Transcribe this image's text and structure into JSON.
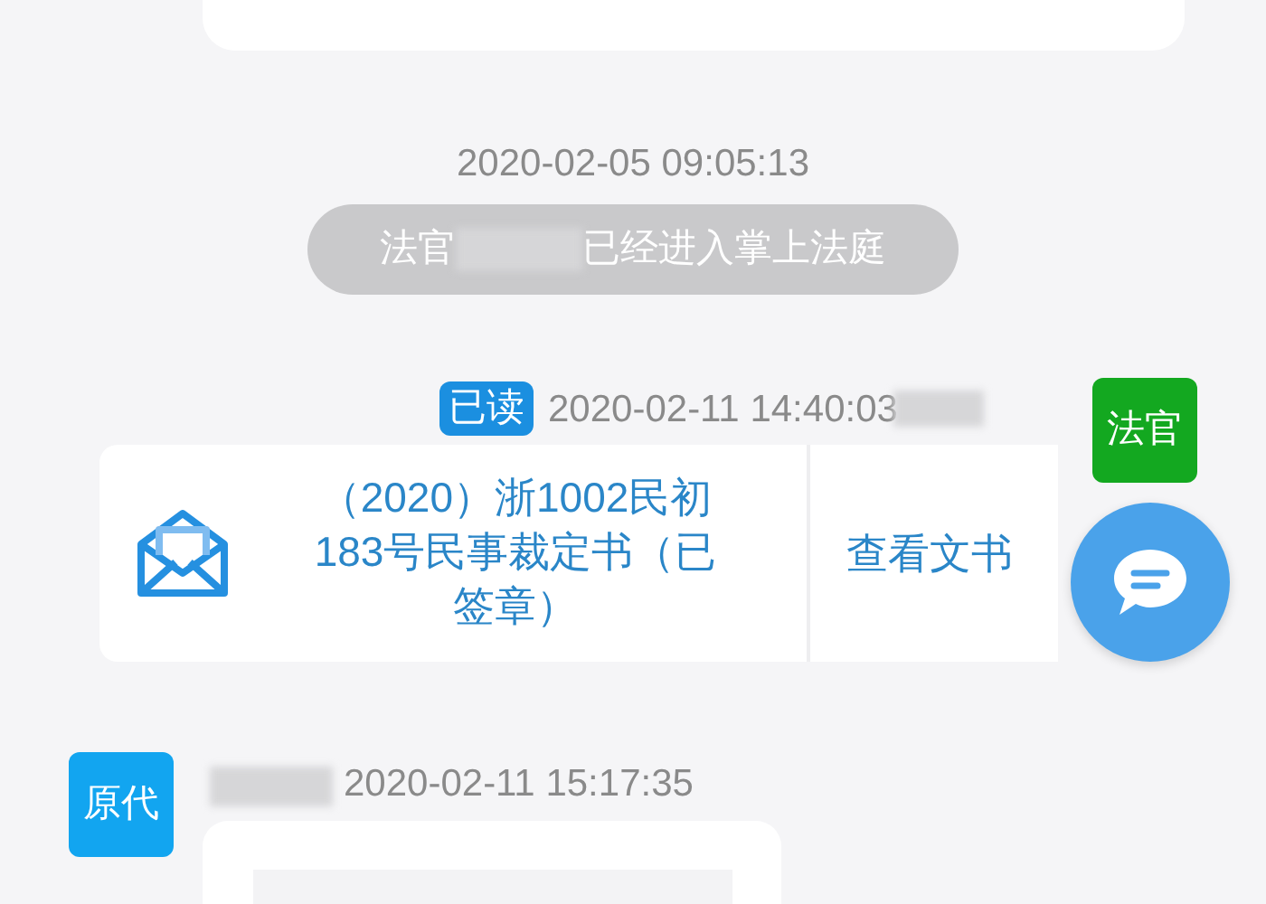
{
  "system_event": {
    "time": "2020-02-05 09:05:13",
    "text_before": "法官",
    "text_after": "已经进入掌上法庭"
  },
  "outgoing": {
    "read_badge": "已读",
    "time": "2020-02-11 14:40:03",
    "avatar": "法官",
    "document_title": "（2020）浙1002民初183号民事裁定书（已签章）",
    "action": "查看文书"
  },
  "incoming": {
    "avatar": "原代",
    "time": "2020-02-11 15:17:35"
  }
}
